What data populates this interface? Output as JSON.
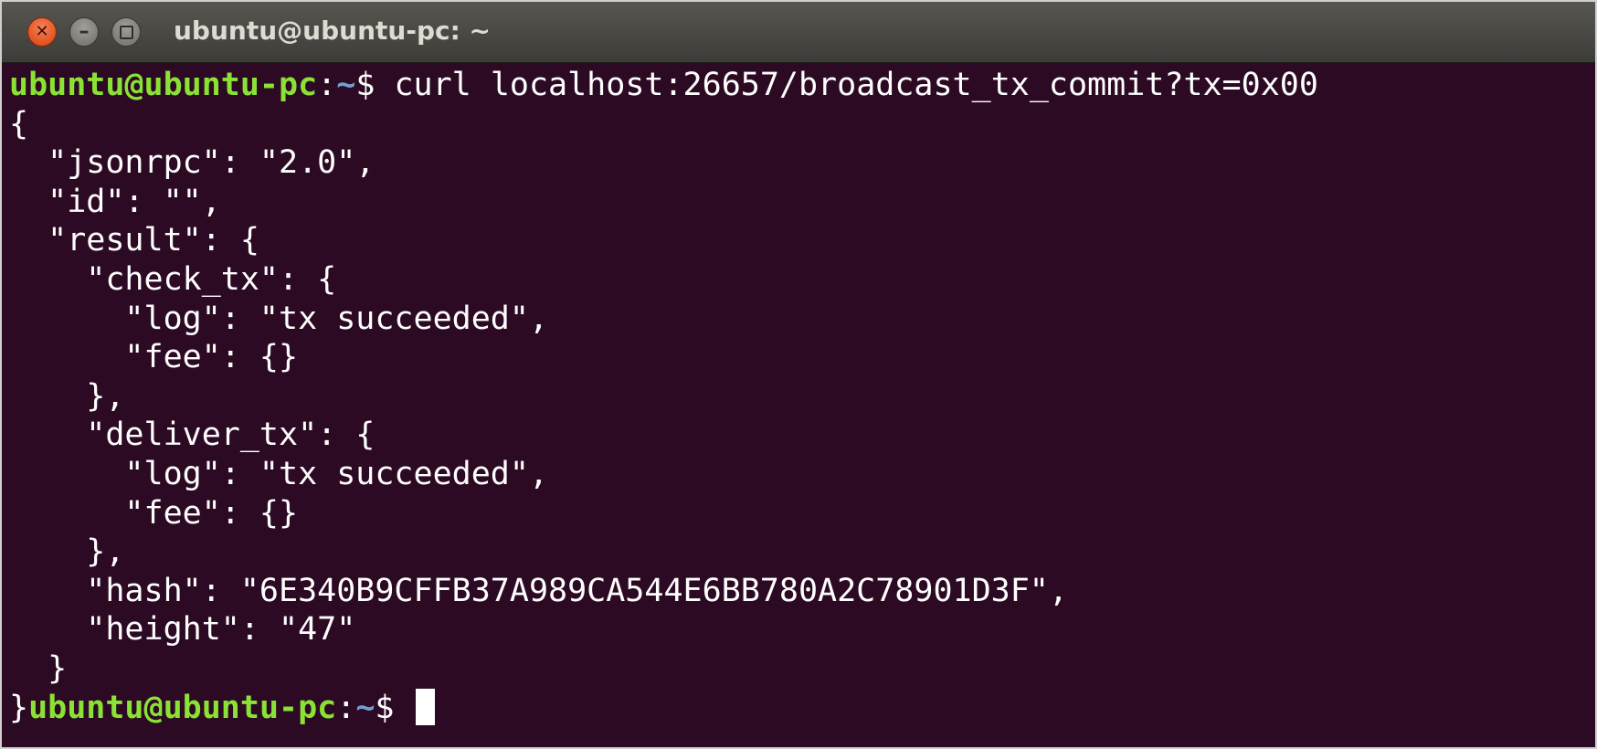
{
  "window": {
    "title": "ubuntu@ubuntu-pc: ~"
  },
  "icons": {
    "close": "close-icon",
    "minimize": "minimize-icon",
    "maximize": "maximize-icon"
  },
  "colors": {
    "background": "#2c0a23",
    "prompt_user": "#8ae234",
    "prompt_path": "#729fcf",
    "text": "#ffffff"
  },
  "prompt": {
    "user_host": "ubuntu@ubuntu-pc",
    "separator": ":",
    "path": "~",
    "symbol": "$ "
  },
  "command": "curl localhost:26657/broadcast_tx_commit?tx=0x00",
  "output_lines": [
    "{",
    "  \"jsonrpc\": \"2.0\",",
    "  \"id\": \"\",",
    "  \"result\": {",
    "    \"check_tx\": {",
    "      \"log\": \"tx succeeded\",",
    "      \"fee\": {}",
    "    },",
    "    \"deliver_tx\": {",
    "      \"log\": \"tx succeeded\",",
    "      \"fee\": {}",
    "    },",
    "    \"hash\": \"6E340B9CFFB37A989CA544E6BB780A2C78901D3F\",",
    "    \"height\": \"47\"",
    "  }"
  ],
  "final_line_prefix": "}"
}
